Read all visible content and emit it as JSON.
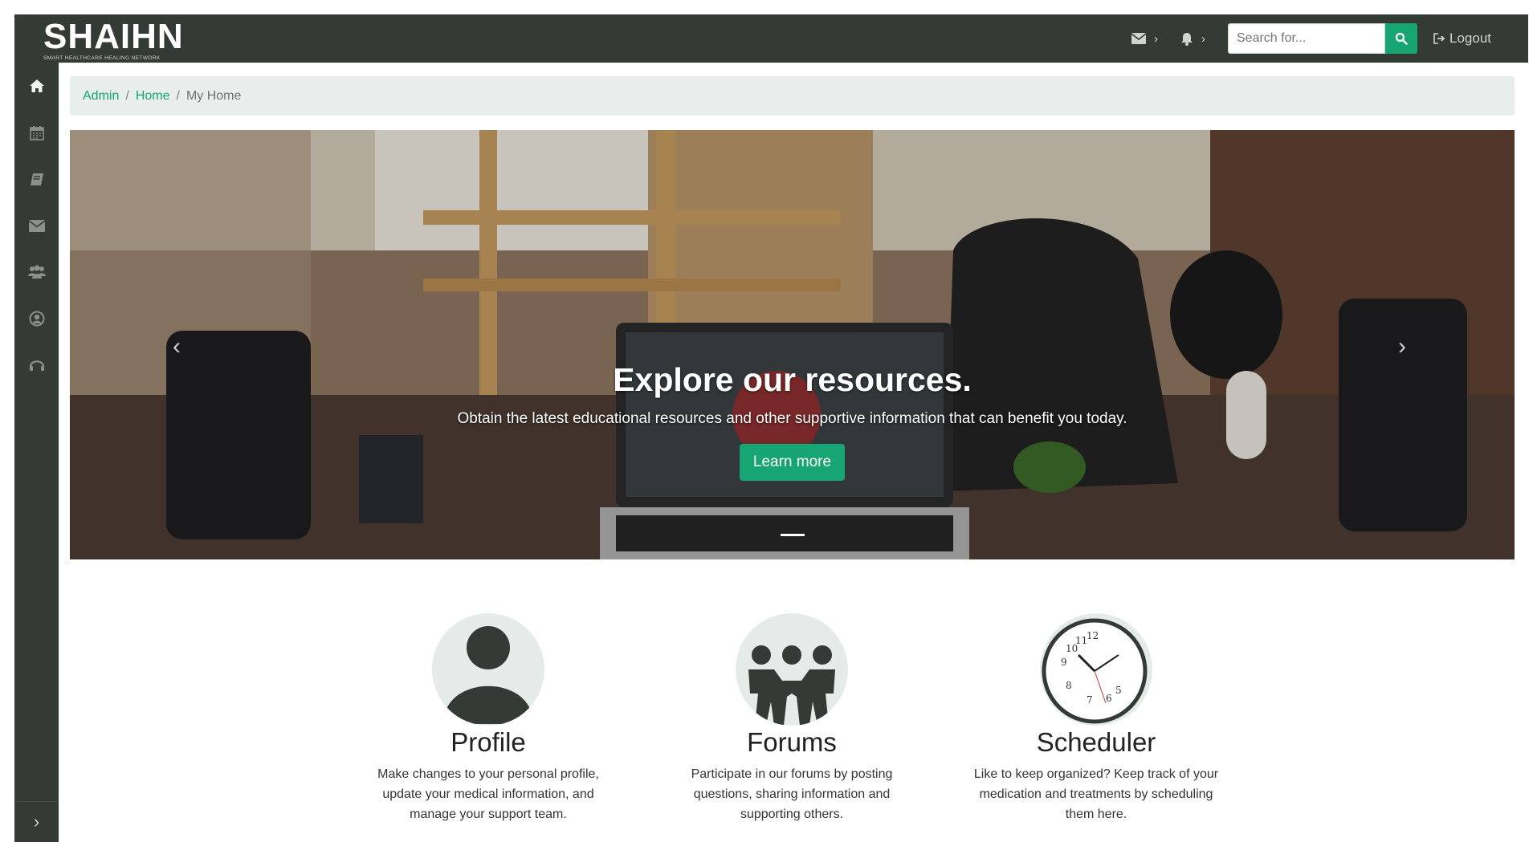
{
  "brand": {
    "name": "SHAIHN",
    "tagline": "SMART HEALTHCARE HEALING NETWORK"
  },
  "topnav": {
    "messages_icon": "envelope-icon",
    "alerts_icon": "bell-icon",
    "search_placeholder": "Search for...",
    "logout_label": "Logout"
  },
  "sidebar": {
    "items": [
      {
        "name": "home",
        "icon": "home-icon"
      },
      {
        "name": "calendar",
        "icon": "calendar-icon"
      },
      {
        "name": "resources",
        "icon": "book-icon"
      },
      {
        "name": "messages",
        "icon": "envelope-icon"
      },
      {
        "name": "forums",
        "icon": "users-icon"
      },
      {
        "name": "profile",
        "icon": "user-circle-icon"
      },
      {
        "name": "support",
        "icon": "headset-icon"
      }
    ],
    "toggle_label": "›"
  },
  "breadcrumb": {
    "items": [
      "Admin",
      "Home"
    ],
    "current": "My Home"
  },
  "carousel": {
    "title": "Explore our resources.",
    "text": "Obtain the latest educational resources and other supportive information that can benefit you today.",
    "button_label": "Learn more",
    "prev_label": "‹",
    "next_label": "›"
  },
  "features": [
    {
      "title": "Profile",
      "description": "Make changes to your personal profile, update your medical information, and manage your support team.",
      "icon": "person-icon"
    },
    {
      "title": "Forums",
      "description": "Participate in our forums by posting questions, sharing information and supporting others.",
      "icon": "people-group-icon"
    },
    {
      "title": "Scheduler",
      "description": "Like to keep organized? Keep track of your medication and treatments by scheduling them here.",
      "icon": "clock-icon"
    }
  ],
  "colors": {
    "topbar": "#343a36",
    "accent": "#17a673",
    "breadcrumb_bg": "#e8eeec",
    "icon_circle": "#e4ebe8"
  }
}
